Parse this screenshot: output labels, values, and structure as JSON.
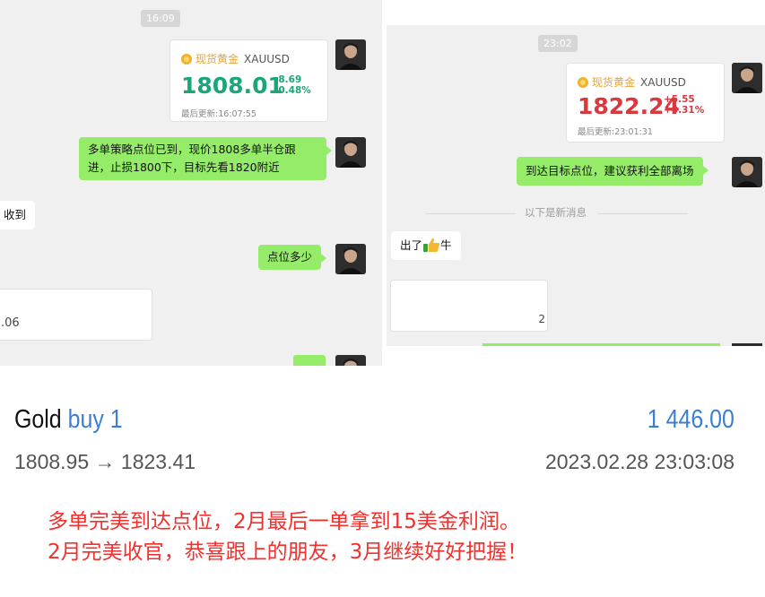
{
  "colors": {
    "up": "#1aa57a",
    "down": "#d9383f",
    "bubble": "#95ec69",
    "accent_blue": "#3a7fd5",
    "caption_red": "#f2302d"
  },
  "left_chat": {
    "timestamp": "16:09",
    "quote_card": {
      "name": "现货黄金",
      "symbol": "XAUUSD",
      "price": "1808.01",
      "change": "-8.69",
      "change_pct": "-0.48%",
      "updated": "最后更新:16:07:55"
    },
    "messages": [
      {
        "text": "多单策略点位已到，现价1808多单半仓跟进，止损1800下，目标先看1820附近"
      },
      {
        "text": "收到"
      },
      {
        "text": "点位多少"
      }
    ],
    "partial_card_text": ".06"
  },
  "right_chat": {
    "timestamp": "23:02",
    "quote_card": {
      "name": "现货黄金",
      "symbol": "XAUUSD",
      "price": "1822.24",
      "change": "+5.55",
      "change_pct": "+0.31%",
      "updated": "最后更新:23:01:31"
    },
    "messages": [
      {
        "text": "到达目标点位，建议获利全部离场"
      },
      {
        "text_before": "出了",
        "emoji": "thumbs-up",
        "text_after": "牛"
      }
    ],
    "new_messages_divider": "以下是新消息",
    "partial_card_text": "2"
  },
  "trade_summary": {
    "instrument": "Gold",
    "direction": "buy 1",
    "amount": "1 446.00",
    "prices": "1808.95 → 1823.41",
    "datetime": "2023.02.28 23:03:08"
  },
  "caption_lines": [
    "多单完美到达点位，2月最后一单拿到15美金利润。",
    "2月完美收官，恭喜跟上的朋友，3月继续好好把握！"
  ]
}
